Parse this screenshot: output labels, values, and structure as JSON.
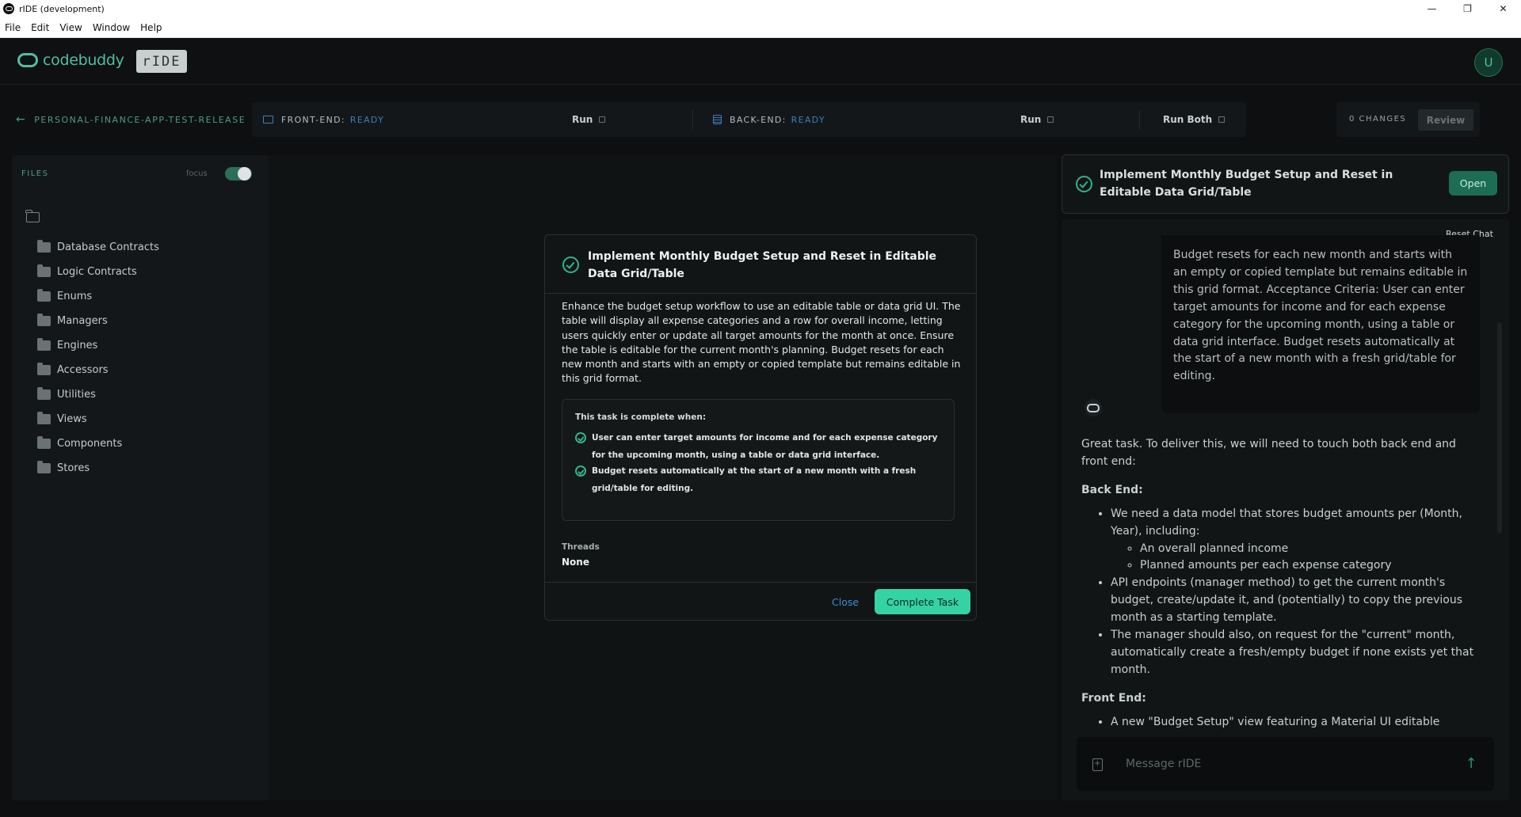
{
  "window": {
    "title": "rIDE (development)",
    "controls": [
      "—",
      "❐",
      "✕"
    ]
  },
  "menu": [
    "File",
    "Edit",
    "View",
    "Window",
    "Help"
  ],
  "header": {
    "logo_text": "codebuddy",
    "badge": "rIDE",
    "avatar_initial": "U"
  },
  "project": {
    "name": "PERSONAL-FINANCE-APP-TEST-RELEASE",
    "frontend": {
      "label": "FRONT-END:",
      "status": "READY",
      "run_label": "Run"
    },
    "backend": {
      "label": "BACK-END:",
      "status": "READY",
      "run_label": "Run"
    },
    "run_both_label": "Run Both",
    "changes": "0 CHANGES",
    "review_label": "Review"
  },
  "files": {
    "title": "FILES",
    "focus_label": "focus",
    "focus_on": true,
    "items": [
      "Database Contracts",
      "Logic Contracts",
      "Enums",
      "Managers",
      "Engines",
      "Accessors",
      "Utilities",
      "Views",
      "Components",
      "Stores"
    ]
  },
  "modal": {
    "title": "Implement Monthly Budget Setup and Reset in Editable Data Grid/Table",
    "description": "Enhance the budget setup workflow to use an editable table or data grid UI. The table will display all expense categories and a row for overall income, letting users quickly enter or update all target amounts for the month at once. Ensure the table is editable for the current month's planning. Budget resets for each new month and starts with an empty or copied template but remains editable in this grid format.",
    "criteria_title": "This task is complete when:",
    "criteria": [
      "User can enter target amounts for income and for each expense category for the upcoming month, using a table or data grid interface.",
      "Budget resets automatically at the start of a new month with a fresh grid/table for editing."
    ],
    "threads_label": "Threads",
    "threads_value": "None",
    "close_label": "Close",
    "complete_label": "Complete Task"
  },
  "task_card": {
    "title": "Implement Monthly Budget Setup and Reset in Editable Data Grid/Table",
    "open_label": "Open"
  },
  "chat": {
    "reset_label": "Reset Chat",
    "user_message": "Budget resets for each new month and starts with an empty or copied template but remains editable in this grid format. Acceptance Criteria: User can enter target amounts for income and for each expense category for the upcoming month, using a table or data grid interface. Budget resets automatically at the start of a new month with a fresh grid/table for editing.",
    "bot_intro": "Great task. To deliver this, we will need to touch both back end and front end:",
    "back_end_heading": "Back End:",
    "back_end_b1": "We need a data model that stores budget amounts per (Month, Year), including:",
    "back_end_b1_sub1": "An overall planned income",
    "back_end_b1_sub2": "Planned amounts per each expense category",
    "back_end_b2": "API endpoints (manager method) to get the current month's budget, create/update it, and (potentially) to copy the previous month as a starting template.",
    "back_end_b3": "The manager should also, on request for the \"current\" month, automatically create a fresh/empty budget if none exists yet that month.",
    "front_end_heading": "Front End:",
    "front_end_b1": "A new \"Budget Setup\" view featuring a Material UI editable",
    "composer_placeholder": "Message rIDE"
  }
}
